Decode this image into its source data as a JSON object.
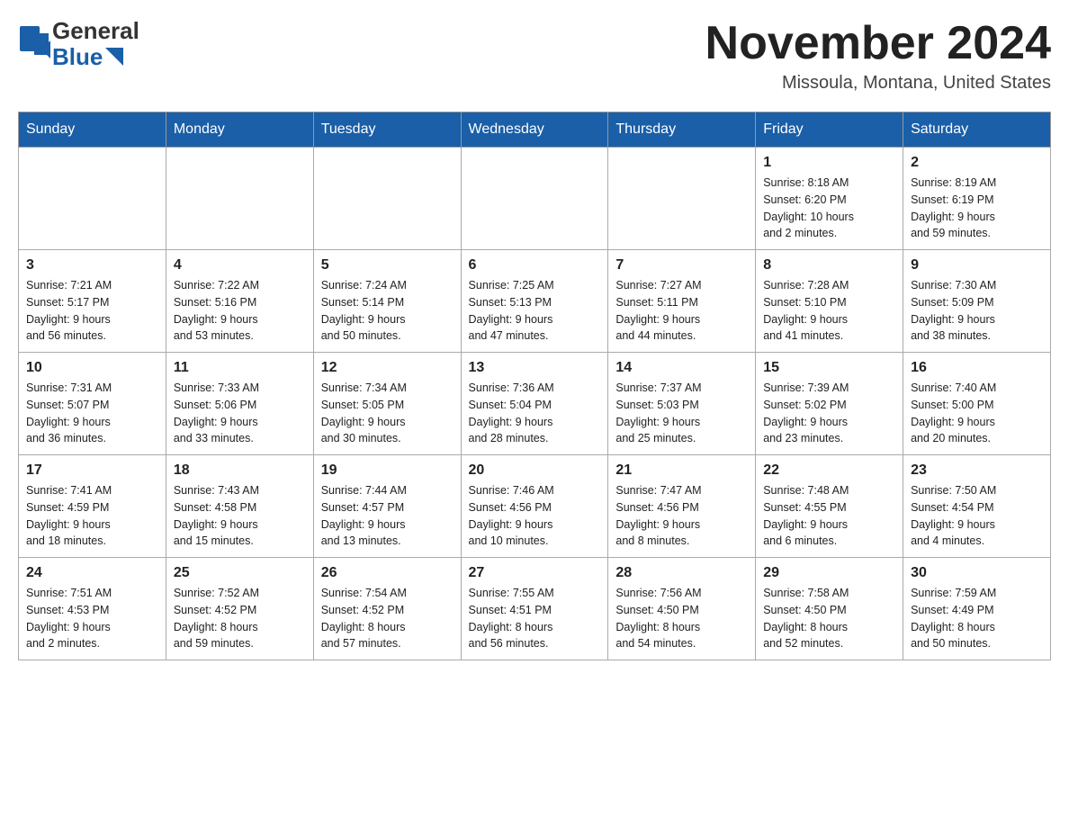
{
  "header": {
    "logo_general": "General",
    "logo_blue": "Blue",
    "month_title": "November 2024",
    "location": "Missoula, Montana, United States"
  },
  "weekdays": [
    "Sunday",
    "Monday",
    "Tuesday",
    "Wednesday",
    "Thursday",
    "Friday",
    "Saturday"
  ],
  "weeks": [
    [
      {
        "day": "",
        "info": ""
      },
      {
        "day": "",
        "info": ""
      },
      {
        "day": "",
        "info": ""
      },
      {
        "day": "",
        "info": ""
      },
      {
        "day": "",
        "info": ""
      },
      {
        "day": "1",
        "info": "Sunrise: 8:18 AM\nSunset: 6:20 PM\nDaylight: 10 hours\nand 2 minutes."
      },
      {
        "day": "2",
        "info": "Sunrise: 8:19 AM\nSunset: 6:19 PM\nDaylight: 9 hours\nand 59 minutes."
      }
    ],
    [
      {
        "day": "3",
        "info": "Sunrise: 7:21 AM\nSunset: 5:17 PM\nDaylight: 9 hours\nand 56 minutes."
      },
      {
        "day": "4",
        "info": "Sunrise: 7:22 AM\nSunset: 5:16 PM\nDaylight: 9 hours\nand 53 minutes."
      },
      {
        "day": "5",
        "info": "Sunrise: 7:24 AM\nSunset: 5:14 PM\nDaylight: 9 hours\nand 50 minutes."
      },
      {
        "day": "6",
        "info": "Sunrise: 7:25 AM\nSunset: 5:13 PM\nDaylight: 9 hours\nand 47 minutes."
      },
      {
        "day": "7",
        "info": "Sunrise: 7:27 AM\nSunset: 5:11 PM\nDaylight: 9 hours\nand 44 minutes."
      },
      {
        "day": "8",
        "info": "Sunrise: 7:28 AM\nSunset: 5:10 PM\nDaylight: 9 hours\nand 41 minutes."
      },
      {
        "day": "9",
        "info": "Sunrise: 7:30 AM\nSunset: 5:09 PM\nDaylight: 9 hours\nand 38 minutes."
      }
    ],
    [
      {
        "day": "10",
        "info": "Sunrise: 7:31 AM\nSunset: 5:07 PM\nDaylight: 9 hours\nand 36 minutes."
      },
      {
        "day": "11",
        "info": "Sunrise: 7:33 AM\nSunset: 5:06 PM\nDaylight: 9 hours\nand 33 minutes."
      },
      {
        "day": "12",
        "info": "Sunrise: 7:34 AM\nSunset: 5:05 PM\nDaylight: 9 hours\nand 30 minutes."
      },
      {
        "day": "13",
        "info": "Sunrise: 7:36 AM\nSunset: 5:04 PM\nDaylight: 9 hours\nand 28 minutes."
      },
      {
        "day": "14",
        "info": "Sunrise: 7:37 AM\nSunset: 5:03 PM\nDaylight: 9 hours\nand 25 minutes."
      },
      {
        "day": "15",
        "info": "Sunrise: 7:39 AM\nSunset: 5:02 PM\nDaylight: 9 hours\nand 23 minutes."
      },
      {
        "day": "16",
        "info": "Sunrise: 7:40 AM\nSunset: 5:00 PM\nDaylight: 9 hours\nand 20 minutes."
      }
    ],
    [
      {
        "day": "17",
        "info": "Sunrise: 7:41 AM\nSunset: 4:59 PM\nDaylight: 9 hours\nand 18 minutes."
      },
      {
        "day": "18",
        "info": "Sunrise: 7:43 AM\nSunset: 4:58 PM\nDaylight: 9 hours\nand 15 minutes."
      },
      {
        "day": "19",
        "info": "Sunrise: 7:44 AM\nSunset: 4:57 PM\nDaylight: 9 hours\nand 13 minutes."
      },
      {
        "day": "20",
        "info": "Sunrise: 7:46 AM\nSunset: 4:56 PM\nDaylight: 9 hours\nand 10 minutes."
      },
      {
        "day": "21",
        "info": "Sunrise: 7:47 AM\nSunset: 4:56 PM\nDaylight: 9 hours\nand 8 minutes."
      },
      {
        "day": "22",
        "info": "Sunrise: 7:48 AM\nSunset: 4:55 PM\nDaylight: 9 hours\nand 6 minutes."
      },
      {
        "day": "23",
        "info": "Sunrise: 7:50 AM\nSunset: 4:54 PM\nDaylight: 9 hours\nand 4 minutes."
      }
    ],
    [
      {
        "day": "24",
        "info": "Sunrise: 7:51 AM\nSunset: 4:53 PM\nDaylight: 9 hours\nand 2 minutes."
      },
      {
        "day": "25",
        "info": "Sunrise: 7:52 AM\nSunset: 4:52 PM\nDaylight: 8 hours\nand 59 minutes."
      },
      {
        "day": "26",
        "info": "Sunrise: 7:54 AM\nSunset: 4:52 PM\nDaylight: 8 hours\nand 57 minutes."
      },
      {
        "day": "27",
        "info": "Sunrise: 7:55 AM\nSunset: 4:51 PM\nDaylight: 8 hours\nand 56 minutes."
      },
      {
        "day": "28",
        "info": "Sunrise: 7:56 AM\nSunset: 4:50 PM\nDaylight: 8 hours\nand 54 minutes."
      },
      {
        "day": "29",
        "info": "Sunrise: 7:58 AM\nSunset: 4:50 PM\nDaylight: 8 hours\nand 52 minutes."
      },
      {
        "day": "30",
        "info": "Sunrise: 7:59 AM\nSunset: 4:49 PM\nDaylight: 8 hours\nand 50 minutes."
      }
    ]
  ]
}
